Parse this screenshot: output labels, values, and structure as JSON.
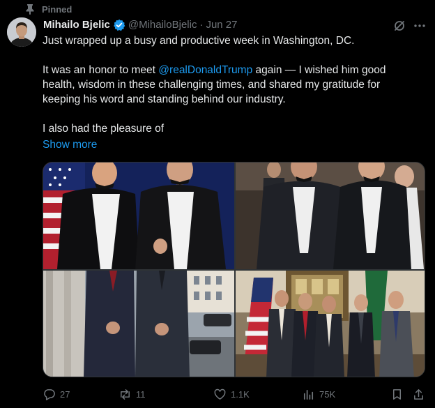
{
  "pinned_label": "Pinned",
  "author": {
    "name": "Mihailo Bjelic",
    "handle": "@MihailoBjelic",
    "separator": "·",
    "date": "Jun 27"
  },
  "tweet": {
    "p1": "Just wrapped up a busy and productive week in Washington, DC.",
    "p2_mention": "@realDonaldTrump",
    "p2_rest": " again — I wished him good health, wisdom in these challenging times, and shared my gratitude for keeping his word and standing behind our industry.",
    "p2_prefix": "It was an honor to meet ",
    "p3": "I also had the pleasure of",
    "show_more": "Show more"
  },
  "actions": {
    "replies": "27",
    "reposts": "11",
    "likes": "1.1K",
    "views": "75K"
  },
  "colors": {
    "accent": "#1d9bf0",
    "muted": "#71767b",
    "text": "#e7e9ea",
    "background": "#000000"
  },
  "icons": [
    "pin-icon",
    "verified-badge-icon",
    "grok-icon",
    "more-icon",
    "reply-icon",
    "repost-icon",
    "like-icon",
    "views-icon",
    "bookmark-icon",
    "share-icon"
  ]
}
